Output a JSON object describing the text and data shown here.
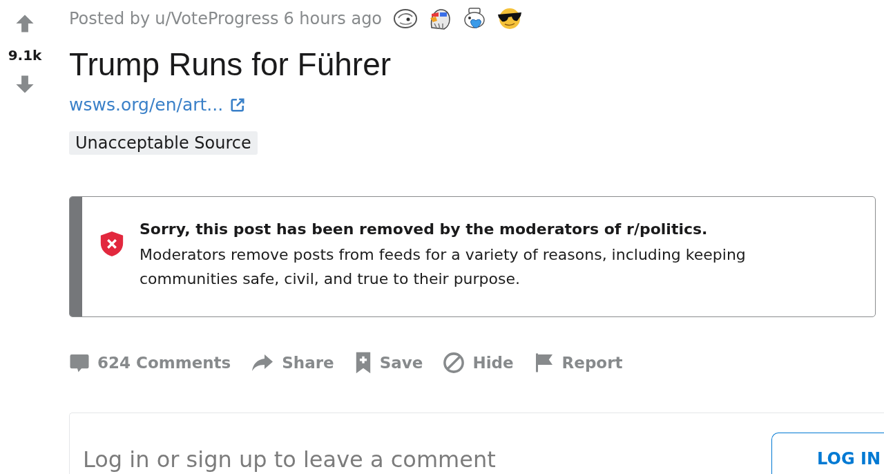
{
  "vote": {
    "score": "9.1k"
  },
  "post": {
    "posted_by": "Posted by",
    "author": "u/VoteProgress",
    "time": "6 hours ago",
    "title": "Trump Runs for Führer",
    "link": "wsws.org/en/art...",
    "flair": "Unacceptable Source"
  },
  "removal_notice": {
    "heading": "Sorry, this post has been removed by the moderators of r/politics.",
    "body": "Moderators remove posts from feeds for a variety of reasons, including keeping communities safe, civil, and true to their purpose."
  },
  "actions": [
    {
      "kind": "comments",
      "label": "624 Comments"
    },
    {
      "kind": "share",
      "label": "Share"
    },
    {
      "kind": "save",
      "label": "Save"
    },
    {
      "kind": "hide",
      "label": "Hide"
    },
    {
      "kind": "report",
      "label": "Report"
    }
  ],
  "comment_prompt": {
    "text": "Log in or sign up to leave a comment",
    "button": "LOG IN"
  }
}
